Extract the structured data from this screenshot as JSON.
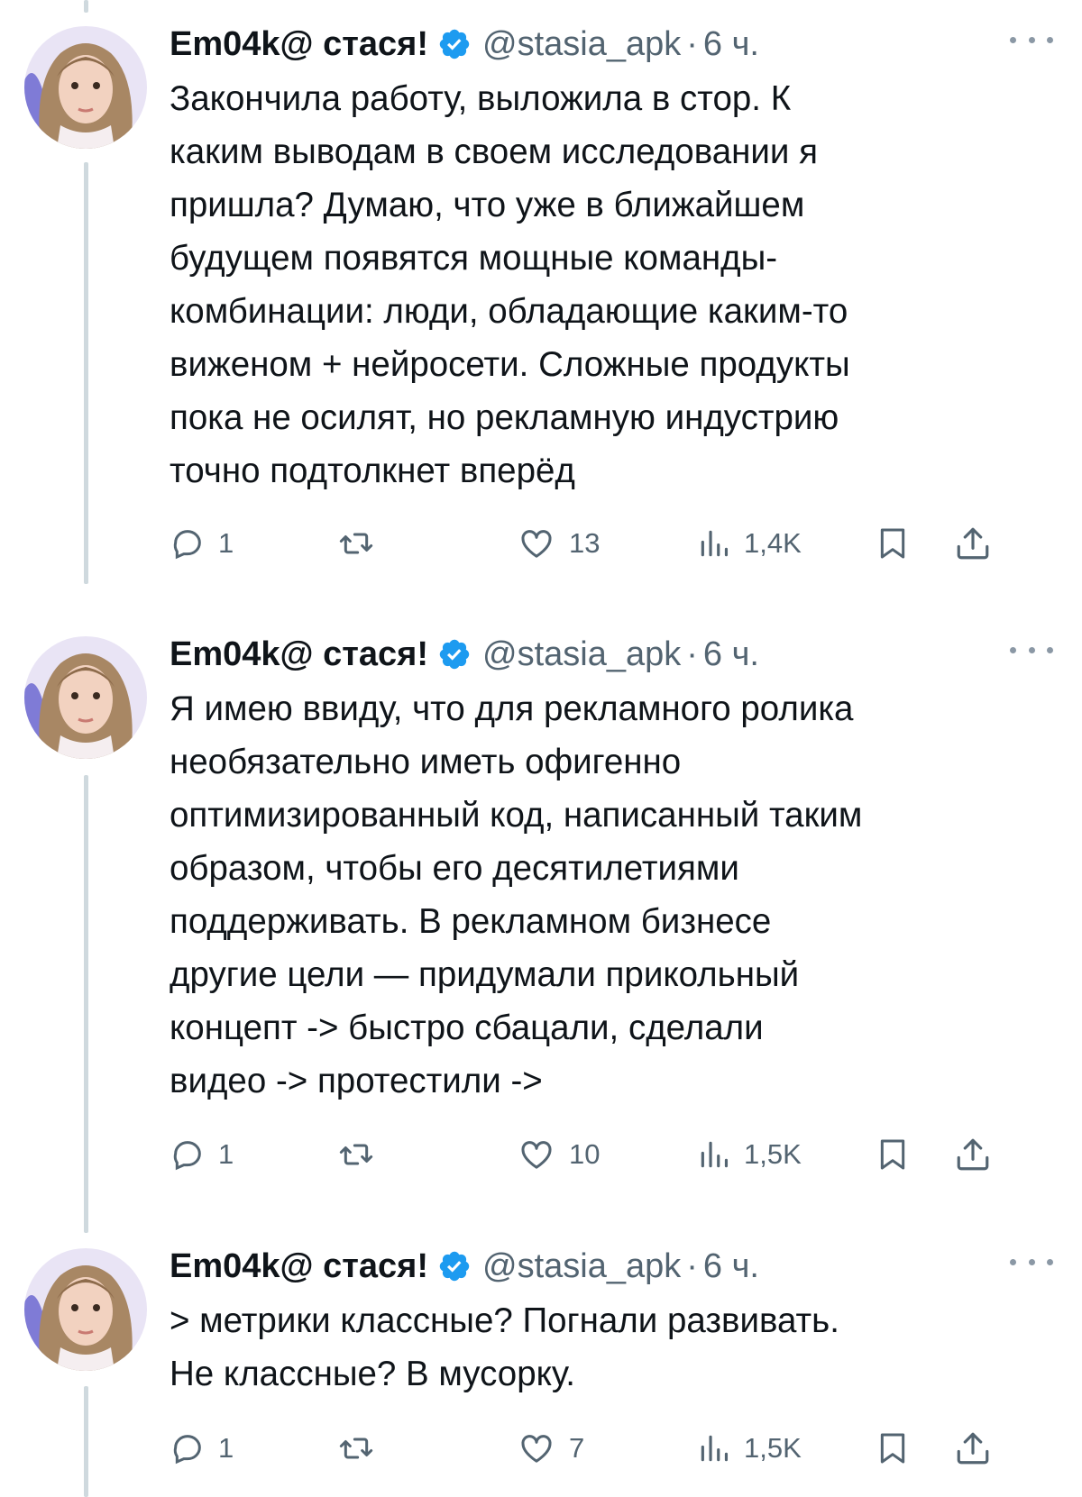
{
  "tweets": [
    {
      "author_name": "Em04k@ стася!",
      "handle": "@stasia_apk",
      "time": "6 ч.",
      "lines": [
        "Закончила работу, выложила в стор. К",
        "каким выводам в своем исследовании я",
        "пришла? Думаю, что уже в ближайшем",
        "будущем появятся мощные команды-",
        "комбинации: люди, обладающие каким-то",
        "виженом + нейросети. Сложные продукты",
        "пока не осилят, но рекламную индустрию",
        "точно подтолкнет вперёд"
      ],
      "replies": "1",
      "likes": "13",
      "views": "1,4K"
    },
    {
      "author_name": "Em04k@ стася!",
      "handle": "@stasia_apk",
      "time": "6 ч.",
      "lines": [
        "Я имею ввиду, что для рекламного ролика",
        "необязательно иметь офигенно",
        "оптимизированный код, написанный таким",
        "образом, чтобы его десятилетиями",
        "поддерживать. В рекламном бизнесе",
        "другие цели — придумали прикольный",
        "концепт -> быстро сбацали, сделали",
        "видео -> протестили ->"
      ],
      "replies": "1",
      "likes": "10",
      "views": "1,5K"
    },
    {
      "author_name": "Em04k@ стася!",
      "handle": "@stasia_apk",
      "time": "6 ч.",
      "lines": [
        "> метрики классные? Погнали развивать.",
        "Не классные? В мусорку."
      ],
      "replies": "1",
      "likes": "7",
      "views": "1,5K"
    }
  ],
  "colors": {
    "text": "#0f1419",
    "secondary": "#536471",
    "verified": "#1d9bf0",
    "thread_line": "#cfd9de"
  },
  "icons": [
    "reply-icon",
    "retweet-icon",
    "like-icon",
    "views-icon",
    "bookmark-icon",
    "share-icon",
    "verified-badge-icon",
    "more-icon"
  ]
}
